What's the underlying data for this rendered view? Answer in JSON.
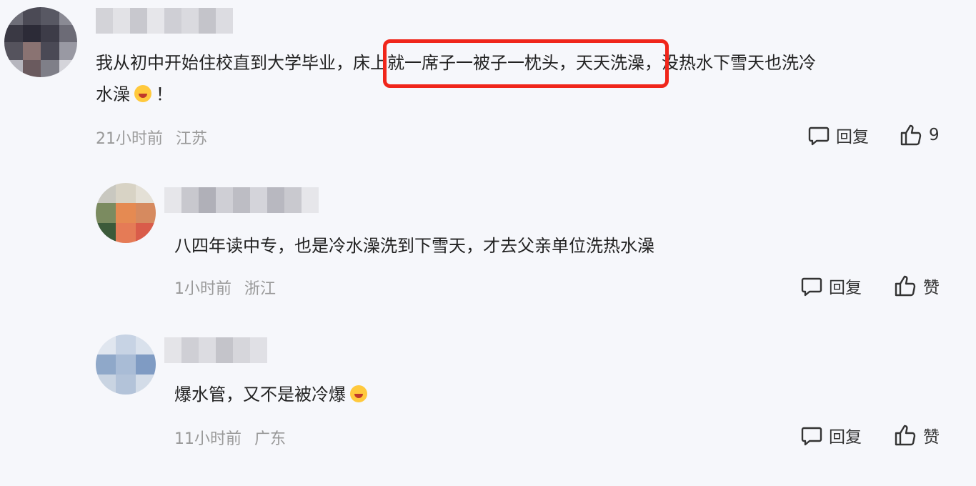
{
  "comments": [
    {
      "text_line1": "我从初中开始住校直到大学毕业，床上就一席子一被子一枕头，天天洗澡，没热水下雪天也洗冷",
      "text_line2_pre": "水澡",
      "text_line2_post": "！",
      "time": "21小时前",
      "location": "江苏",
      "reply_label": "回复",
      "like_label": "9"
    },
    {
      "text": "八四年读中专，也是冷水澡洗到下雪天，才去父亲单位洗热水澡",
      "time": "1小时前",
      "location": "浙江",
      "reply_label": "回复",
      "like_label": "赞"
    },
    {
      "text_pre": "爆水管，又不是被冷爆",
      "time": "11小时前",
      "location": "广东",
      "reply_label": "回复",
      "like_label": "赞"
    }
  ],
  "highlight_color": "#f0261b",
  "icons": {
    "reply": "comment-bubble-icon",
    "like": "thumbs-up-icon",
    "emoji": "laughing-crying-emoji-icon"
  }
}
